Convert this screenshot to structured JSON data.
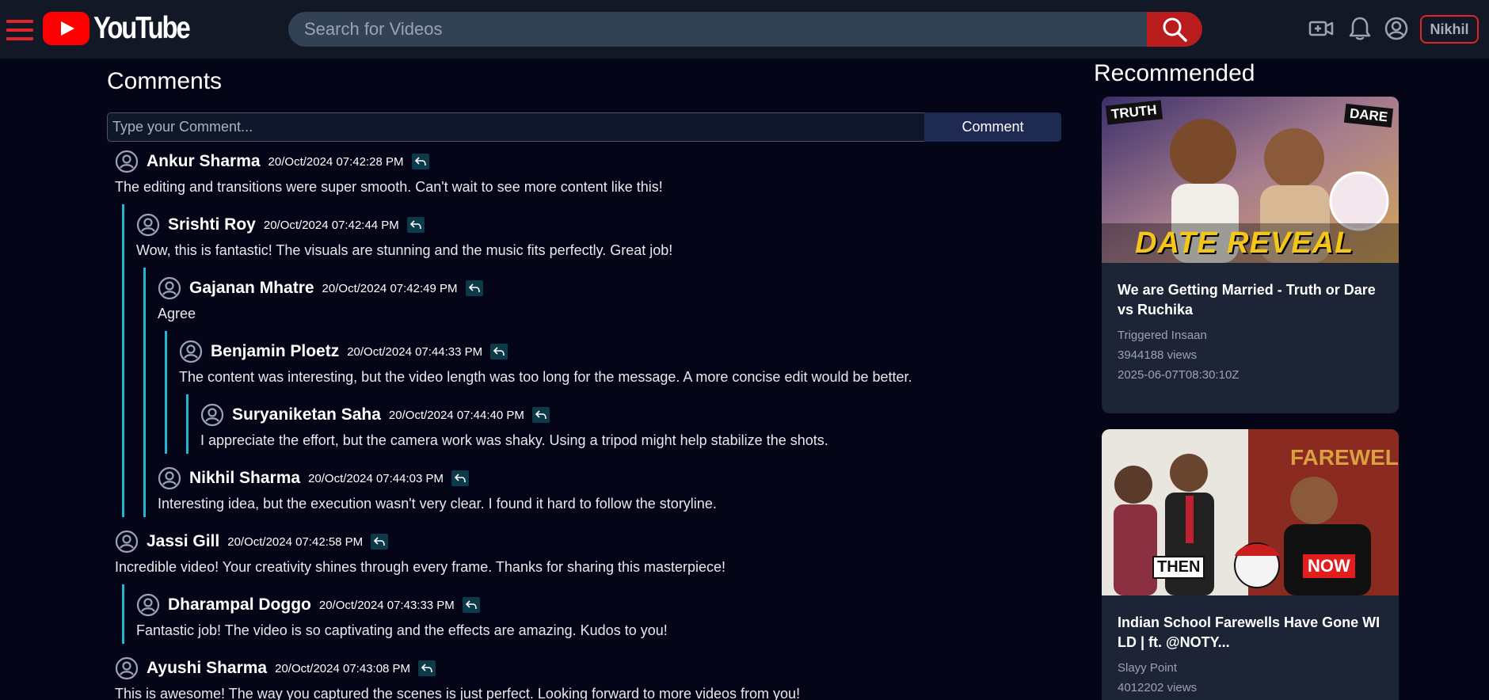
{
  "header": {
    "logo_text": "YouTube",
    "search_placeholder": "Search for Videos",
    "user_label": "Nikhil"
  },
  "comments": {
    "title": "Comments",
    "input_placeholder": "Type your Comment...",
    "submit_label": "Comment",
    "items": [
      {
        "name": "Ankur Sharma",
        "time": "20/Oct/2024 07:42:28 PM",
        "text": "The editing and transitions were super smooth. Can't wait to see more content like this!"
      },
      {
        "name": "Srishti Roy",
        "time": "20/Oct/2024 07:42:44 PM",
        "text": "Wow, this is fantastic! The visuals are stunning and the music fits perfectly. Great job!"
      },
      {
        "name": "Gajanan Mhatre",
        "time": "20/Oct/2024 07:42:49 PM",
        "text": "Agree"
      },
      {
        "name": "Benjamin Ploetz",
        "time": "20/Oct/2024 07:44:33 PM",
        "text": "The content was interesting, but the video length was too long for the message. A more concise edit would be better."
      },
      {
        "name": "Suryaniketan Saha",
        "time": "20/Oct/2024 07:44:40 PM",
        "text": "I appreciate the effort, but the camera work was shaky. Using a tripod might help stabilize the shots."
      },
      {
        "name": "Nikhil Sharma",
        "time": "20/Oct/2024 07:44:03 PM",
        "text": "Interesting idea, but the execution wasn't very clear. I found it hard to follow the storyline."
      },
      {
        "name": "Jassi Gill",
        "time": "20/Oct/2024 07:42:58 PM",
        "text": "Incredible video! Your creativity shines through every frame. Thanks for sharing this masterpiece!"
      },
      {
        "name": "Dharampal Doggo",
        "time": "20/Oct/2024 07:43:33 PM",
        "text": "Fantastic job! The video is so captivating and the effects are amazing. Kudos to you!"
      },
      {
        "name": "Ayushi Sharma",
        "time": "20/Oct/2024 07:43:08 PM",
        "text": "This is awesome! The way you captured the scenes is just perfect. Looking forward to more videos from you!"
      }
    ]
  },
  "recommended": {
    "title": "Recommended",
    "items": [
      {
        "title": "We are Getting Married - Truth or Dare vs Ruchika",
        "channel": "Triggered Insaan",
        "views": "3944188 views",
        "date": "2025-06-07T08:30:10Z",
        "thumb_labels": [
          "TRUTH",
          "DARE",
          "DATE REVEAL"
        ]
      },
      {
        "title": "Indian School Farewells Have Gone WILD | ft. @NOTY...",
        "channel": "Slayy Point",
        "views": "4012202 views",
        "date": "",
        "thumb_labels": [
          "THEN",
          "NOW",
          "FAREWELL"
        ]
      }
    ]
  },
  "colors": {
    "background": "#040617",
    "header": "#121826",
    "accent_red": "#e1252b",
    "thread_line": "#22b8cf",
    "card": "#1d2435"
  }
}
